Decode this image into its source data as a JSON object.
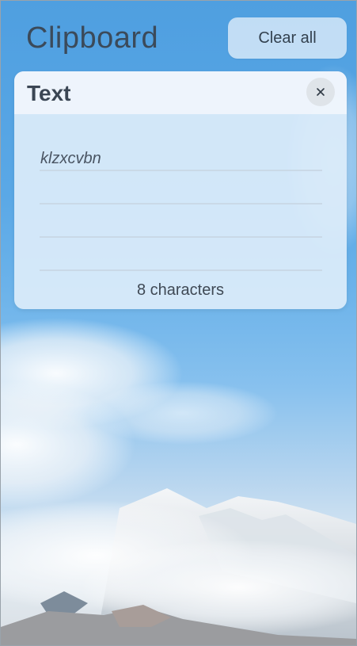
{
  "header": {
    "title": "Clipboard",
    "clear_all_label": "Clear all"
  },
  "clip_item": {
    "type_label": "Text",
    "close_icon": "close-icon",
    "content": "klzxcvbn",
    "char_count": "8 characters"
  },
  "colors": {
    "sky_top": "#4f9fe0",
    "card_bg": "#dcecfa",
    "title_text": "#3b4a5a"
  }
}
